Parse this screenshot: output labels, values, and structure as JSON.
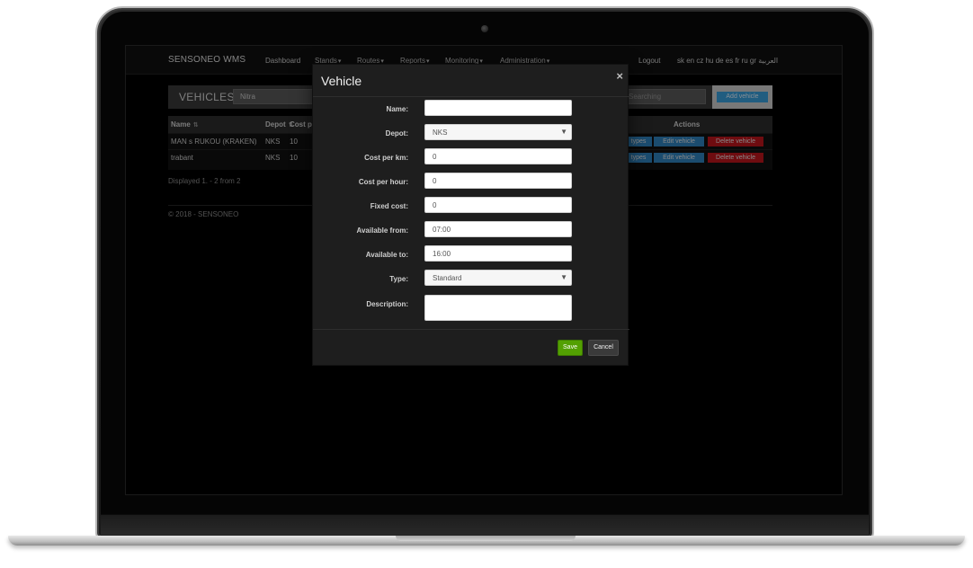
{
  "navbar": {
    "brand": "SENSONEO WMS",
    "items": [
      "Dashboard",
      "Stands",
      "Routes",
      "Reports",
      "Monitoring",
      "Administration"
    ],
    "logout": "Logout",
    "languages": "sk en cz hu de es fr ru gr العربية"
  },
  "page": {
    "title": "VEHICLES",
    "depot_filter_value": "Nitra",
    "search_placeholder": "Searching",
    "add_button": "Add vehicle"
  },
  "table": {
    "headers": {
      "name": "Name",
      "depot": "Depot",
      "cost": "Cost per",
      "actions": "Actions"
    },
    "rows": [
      {
        "name": "MAN s RUKOU (KRAKEN)",
        "depot": "NKS",
        "cost": "10",
        "types": "types",
        "edit": "Edit vehicle",
        "delete": "Delete vehicle"
      },
      {
        "name": "trabant",
        "depot": "NKS",
        "cost": "10",
        "types": "types",
        "edit": "Edit vehicle",
        "delete": "Delete vehicle"
      }
    ],
    "status": "Displayed 1. - 2 from 2"
  },
  "footer": {
    "copyright": "© 2018 - SENSONEO"
  },
  "modal": {
    "title": "Vehicle",
    "close": "×",
    "fields": {
      "name": {
        "label": "Name:",
        "value": ""
      },
      "depot": {
        "label": "Depot:",
        "value": "NKS"
      },
      "cost_km": {
        "label": "Cost per km:",
        "value": "0"
      },
      "cost_hour": {
        "label": "Cost per hour:",
        "value": "0"
      },
      "fixed_cost": {
        "label": "Fixed cost:",
        "value": "0"
      },
      "available_from": {
        "label": "Available from:",
        "value": "07:00"
      },
      "available_to": {
        "label": "Available to:",
        "value": "16:00"
      },
      "type": {
        "label": "Type:",
        "value": "Standard"
      },
      "description": {
        "label": "Description:",
        "value": ""
      }
    },
    "save": "Save",
    "cancel": "Cancel"
  },
  "colors": {
    "save_green": "#53a002",
    "edit_blue": "#2f84c0",
    "delete_red": "#c0151c",
    "add_blue": "#3aa0dd"
  }
}
